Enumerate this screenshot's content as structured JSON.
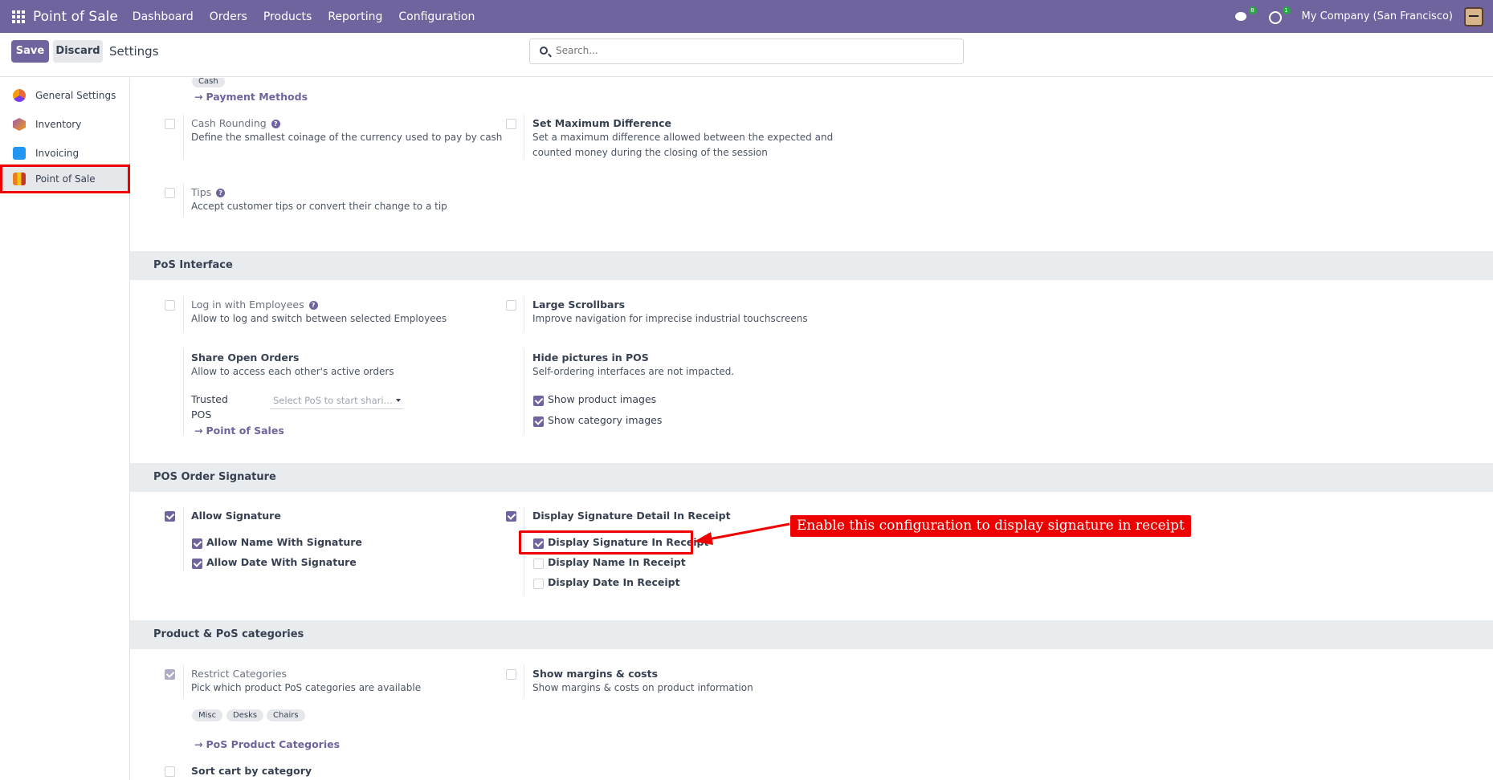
{
  "topbar": {
    "app_name": "Point of Sale",
    "menu": [
      "Dashboard",
      "Orders",
      "Products",
      "Reporting",
      "Configuration"
    ],
    "chat_badge": "8",
    "activity_badge": "1",
    "company": "My Company (San Francisco)"
  },
  "control": {
    "save_label": "Save",
    "discard_label": "Discard",
    "title": "Settings",
    "search_placeholder": "Search..."
  },
  "sidebar": {
    "items": [
      {
        "label": "General Settings",
        "icon": "general-settings-icon"
      },
      {
        "label": "Inventory",
        "icon": "inventory-icon"
      },
      {
        "label": "Invoicing",
        "icon": "invoicing-icon"
      },
      {
        "label": "Point of Sale",
        "icon": "point-of-sale-icon",
        "active": true
      }
    ]
  },
  "payments": {
    "cash_tag": "Cash",
    "payment_methods_link": "Payment Methods",
    "cash_rounding": {
      "title": "Cash Rounding",
      "desc": "Define the smallest coinage of the currency used to pay by cash",
      "checked": false
    },
    "max_difference": {
      "title": "Set Maximum Difference",
      "desc_line1": "Set a maximum difference allowed between the expected and",
      "desc_line2": "counted money during the closing of the session",
      "checked": false
    },
    "tips": {
      "title": "Tips",
      "desc": "Accept customer tips or convert their change to a tip",
      "checked": false
    }
  },
  "pos_interface": {
    "header": "PoS Interface",
    "login_employees": {
      "title": "Log in with Employees",
      "desc": "Allow to log and switch between selected Employees",
      "checked": false
    },
    "large_scrollbars": {
      "title": "Large Scrollbars",
      "desc": "Improve navigation for imprecise industrial touchscreens",
      "checked": false
    },
    "share_open_orders": {
      "title": "Share Open Orders",
      "desc": "Allow to access each other's active orders"
    },
    "trusted_pos_label_1": "Trusted",
    "trusted_pos_label_2": "POS",
    "trusted_pos_placeholder": "Select PoS to start shari...",
    "point_of_sales_link": "Point of Sales",
    "hide_pictures": {
      "title": "Hide pictures in POS",
      "desc": "Self-ordering interfaces are not impacted."
    },
    "show_product_images": {
      "label": "Show product images",
      "checked": true
    },
    "show_category_images": {
      "label": "Show category images",
      "checked": true
    }
  },
  "signature": {
    "header": "POS Order Signature",
    "allow_signature": {
      "label": "Allow Signature",
      "checked": true
    },
    "allow_name": {
      "label": "Allow Name With Signature",
      "checked": true
    },
    "allow_date": {
      "label": "Allow Date With Signature",
      "checked": true
    },
    "display_detail": {
      "label": "Display Signature Detail In Receipt",
      "checked": true
    },
    "display_signature": {
      "label": "Display Signature In Receipt",
      "checked": true
    },
    "display_name": {
      "label": "Display Name In Receipt",
      "checked": false
    },
    "display_date": {
      "label": "Display Date In Receipt",
      "checked": false
    }
  },
  "categories": {
    "header": "Product & PoS categories",
    "restrict": {
      "title": "Restrict Categories",
      "desc": "Pick which product PoS categories are available",
      "checked": true
    },
    "tags": [
      "Misc",
      "Desks",
      "Chairs"
    ],
    "pos_product_categories_link": "PoS Product Categories",
    "margins": {
      "title": "Show margins & costs",
      "desc": "Show margins & costs on product information",
      "checked": false
    },
    "sort_cart": {
      "title": "Sort cart by category",
      "checked": false
    }
  },
  "annotation": {
    "callout_text": "Enable this configuration to display signature in receipt",
    "color": "#ee0000"
  },
  "colors": {
    "brand": "#71639e",
    "section_bg": "#e9ecef"
  }
}
